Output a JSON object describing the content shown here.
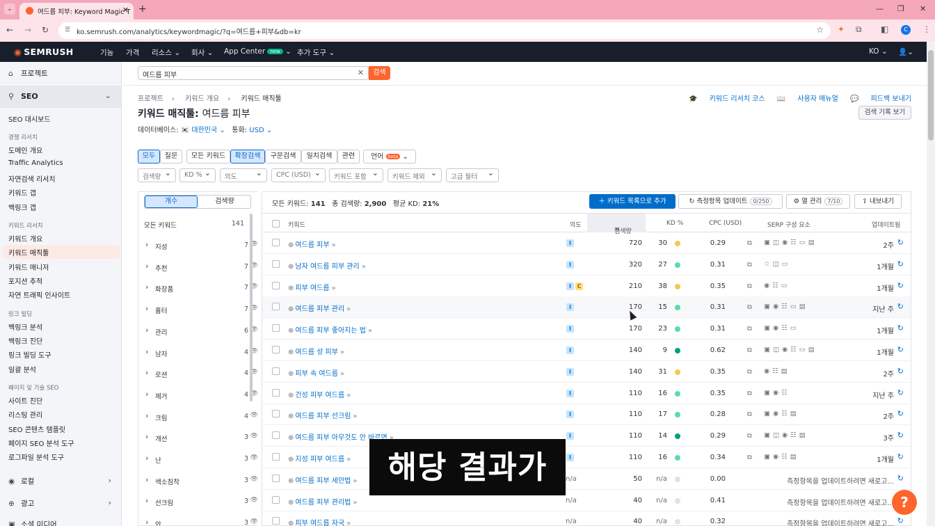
{
  "browser": {
    "tab_title": "여드름 피부: Keyword Magic T",
    "url": "ko.semrush.com/analytics/keywordmagic/?q=여드름+피부&db=kr",
    "profile_initial": "C"
  },
  "topnav": {
    "logo": "SEMRUSH",
    "items": [
      "기능",
      "가격",
      "리소스",
      "회사",
      "App Center",
      "추가 도구"
    ],
    "new_badge": "new",
    "lang": "KO"
  },
  "sidebar": {
    "projects": "프로젝트",
    "seo": "SEO",
    "seo_dashboard": "SEO 대시보드",
    "cat_competitive": "경쟁 리서치",
    "competitive": [
      "도메인 개요",
      "Traffic Analytics",
      "자연검색 리서치",
      "키워드 갭",
      "백링크 갭"
    ],
    "cat_keyword": "키워드 리서치",
    "keyword": [
      "키워드 개요",
      "키워드 매직툴",
      "키워드 매니저",
      "포지션 추적",
      "자연 트래픽 인사이트"
    ],
    "cat_link": "링크 빌딩",
    "link": [
      "백링크 분석",
      "백링크 진단",
      "링크 빌딩 도구",
      "일괄 분석"
    ],
    "cat_onpage": "페이지 및 기술 SEO",
    "onpage": [
      "사이트 진단",
      "리스팅 관리",
      "SEO 콘텐츠 템플릿",
      "페이지 SEO 분석 도구",
      "로그파일 분석 도구"
    ],
    "local": "로컬",
    "ads": "광고",
    "social": "소셜 미디어"
  },
  "search": {
    "value": "여드름 피부",
    "button": "검색"
  },
  "breadcrumb": [
    "프로젝트",
    "키워드 개요",
    "키워드 매직툴"
  ],
  "page": {
    "title": "키워드 매직툴:",
    "keyword": "여드름 피부",
    "db_label": "데이터베이스:",
    "db_value": "대한민국",
    "currency_label": "통화:",
    "currency_value": "USD",
    "course": "키워드 리서치 코스",
    "manual": "사용자 매뉴얼",
    "feedback": "피드백 보내기",
    "history": "검색 기록 보기"
  },
  "filters": {
    "chips1": [
      "모두",
      "질문"
    ],
    "chips2": [
      "모든 키워드",
      "확장검색",
      "구문검색",
      "일치검색",
      "관련"
    ],
    "lang": "언어",
    "beta": "beta",
    "dropdowns": [
      "검색량",
      "KD %",
      "의도",
      "CPC (USD)",
      "키워드 포함",
      "키워드 제외",
      "고급 필터"
    ]
  },
  "groups": {
    "tab_count": "개수",
    "tab_volume": "검색량",
    "all_label": "모든 키워드",
    "all_count": "141",
    "items": [
      {
        "name": "지성",
        "count": "7"
      },
      {
        "name": "추천",
        "count": "7"
      },
      {
        "name": "화장품",
        "count": "7"
      },
      {
        "name": "흉터",
        "count": "7"
      },
      {
        "name": "관리",
        "count": "6"
      },
      {
        "name": "남자",
        "count": "4"
      },
      {
        "name": "로션",
        "count": "4"
      },
      {
        "name": "제거",
        "count": "4"
      },
      {
        "name": "크림",
        "count": "4"
      },
      {
        "name": "개선",
        "count": "3"
      },
      {
        "name": "난",
        "count": "3"
      },
      {
        "name": "색소침착",
        "count": "3"
      },
      {
        "name": "선크림",
        "count": "3"
      },
      {
        "name": "안",
        "count": "3"
      }
    ]
  },
  "summary": {
    "all_label": "모든 키워드:",
    "all_value": "141",
    "vol_label": "총 검색량:",
    "vol_value": "2,900",
    "kd_label": "평균 KD:",
    "kd_value": "21%"
  },
  "toolbar": {
    "add": "키워드 목록으로 추가",
    "update": "측정항목 업데이트",
    "update_count": "0/250",
    "columns": "열 관리",
    "columns_count": "7/10",
    "export": "내보내기"
  },
  "columns": [
    "키워드",
    "의도",
    "검색량",
    "KD %",
    "CPC (USD)",
    "SERP 구성 요소",
    "업데이트됨"
  ],
  "rows": [
    {
      "kw": "여드름 피부",
      "intent": [
        "I"
      ],
      "vol": "720",
      "kd": "30",
      "kdc": "#f2c94c",
      "cpc": "0.29",
      "serp": "▣◫◉☷▭▤",
      "upd": "2주"
    },
    {
      "kw": "남자 여드름 피부 관리",
      "intent": [
        "I"
      ],
      "vol": "320",
      "kd": "27",
      "kdc": "#59ddaa",
      "cpc": "0.31",
      "serp": "☆◫▭",
      "upd": "1개월"
    },
    {
      "kw": "피부 여드름",
      "intent": [
        "I",
        "C"
      ],
      "vol": "210",
      "kd": "38",
      "kdc": "#f2c94c",
      "cpc": "0.35",
      "serp": "◉☷▭",
      "upd": "1개월"
    },
    {
      "kw": "여드름 피부 관리",
      "intent": [
        "I"
      ],
      "vol": "170",
      "kd": "15",
      "kdc": "#59ddaa",
      "cpc": "0.31",
      "serp": "▣◉☷▭▤",
      "upd": "지난 주"
    },
    {
      "kw": "여드름 피부 좋아지는 법",
      "intent": [
        "I"
      ],
      "vol": "170",
      "kd": "23",
      "kdc": "#59ddaa",
      "cpc": "0.31",
      "serp": "▣◉☷▭",
      "upd": "1개월"
    },
    {
      "kw": "여드름 성 피부",
      "intent": [
        "I"
      ],
      "vol": "140",
      "kd": "9",
      "kdc": "#009f81",
      "cpc": "0.62",
      "serp": "▣◫◉☷▭▤",
      "upd": "1개월"
    },
    {
      "kw": "피부 속 여드름",
      "intent": [
        "I"
      ],
      "vol": "140",
      "kd": "31",
      "kdc": "#f2c94c",
      "cpc": "0.35",
      "serp": "◉☷▤",
      "upd": "2주"
    },
    {
      "kw": "건성 피부 여드름",
      "intent": [
        "I"
      ],
      "vol": "110",
      "kd": "16",
      "kdc": "#59ddaa",
      "cpc": "0.35",
      "serp": "▣◉☷",
      "upd": "지난 주"
    },
    {
      "kw": "여드름 피부 선크림",
      "intent": [
        "I"
      ],
      "vol": "110",
      "kd": "17",
      "kdc": "#59ddaa",
      "cpc": "0.28",
      "serp": "▣◉☷▤",
      "upd": "2주"
    },
    {
      "kw": "여드름 피부 아무것도 안 바르면",
      "intent": [
        "I"
      ],
      "vol": "110",
      "kd": "14",
      "kdc": "#009f81",
      "cpc": "0.29",
      "serp": "▣◫◉☷▤",
      "upd": "3주"
    },
    {
      "kw": "지성 피부 여드름",
      "intent": [
        "I"
      ],
      "vol": "110",
      "kd": "16",
      "kdc": "#59ddaa",
      "cpc": "0.34",
      "serp": "▣◉☷▤",
      "upd": "1개월"
    },
    {
      "kw": "여드름 피부 세안법",
      "intent": [],
      "vol": "50",
      "kd": "n/a",
      "kdc": "#e0e1e9",
      "cpc": "0.00",
      "serp": "",
      "upd": "측정항목을 업데이트하려면 새로고..."
    },
    {
      "kw": "여드름 피부 관리법",
      "intent": [],
      "vol": "40",
      "kd": "n/a",
      "kdc": "#e0e1e9",
      "cpc": "0.41",
      "serp": "",
      "upd": "측정항목을 업데이트하려면 새로고..."
    },
    {
      "kw": "피부 여드름 자국",
      "intent": [],
      "vol": "40",
      "kd": "n/a",
      "kdc": "#e0e1e9",
      "cpc": "0.32",
      "serp": "",
      "upd": "측정항목을 업데이트하려면 새로고..."
    }
  ],
  "na": "n/a",
  "caption": "해당 결과가",
  "help": "?"
}
